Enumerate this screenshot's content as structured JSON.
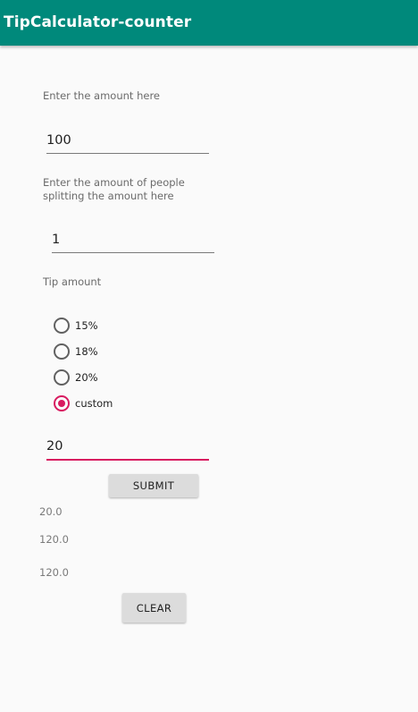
{
  "app_bar": {
    "title": "TipCalculator-counter",
    "color": "#00897b"
  },
  "amount": {
    "label": "Enter the amount here",
    "value": "100"
  },
  "people": {
    "label_line1": "Enter the amount of people",
    "label_line2": "splitting the amount here",
    "value": "1"
  },
  "tip": {
    "label": "Tip amount",
    "options": [
      {
        "label": "15%",
        "checked": false
      },
      {
        "label": "18%",
        "checked": false
      },
      {
        "label": "20%",
        "checked": false
      },
      {
        "label": "custom",
        "checked": true
      }
    ],
    "custom_value": "20",
    "accent_color": "#d81b60"
  },
  "buttons": {
    "submit": "SUBMIT",
    "clear": "CLEAR"
  },
  "results": {
    "tip": "20.0",
    "total": "120.0",
    "per_person": "120.0"
  }
}
